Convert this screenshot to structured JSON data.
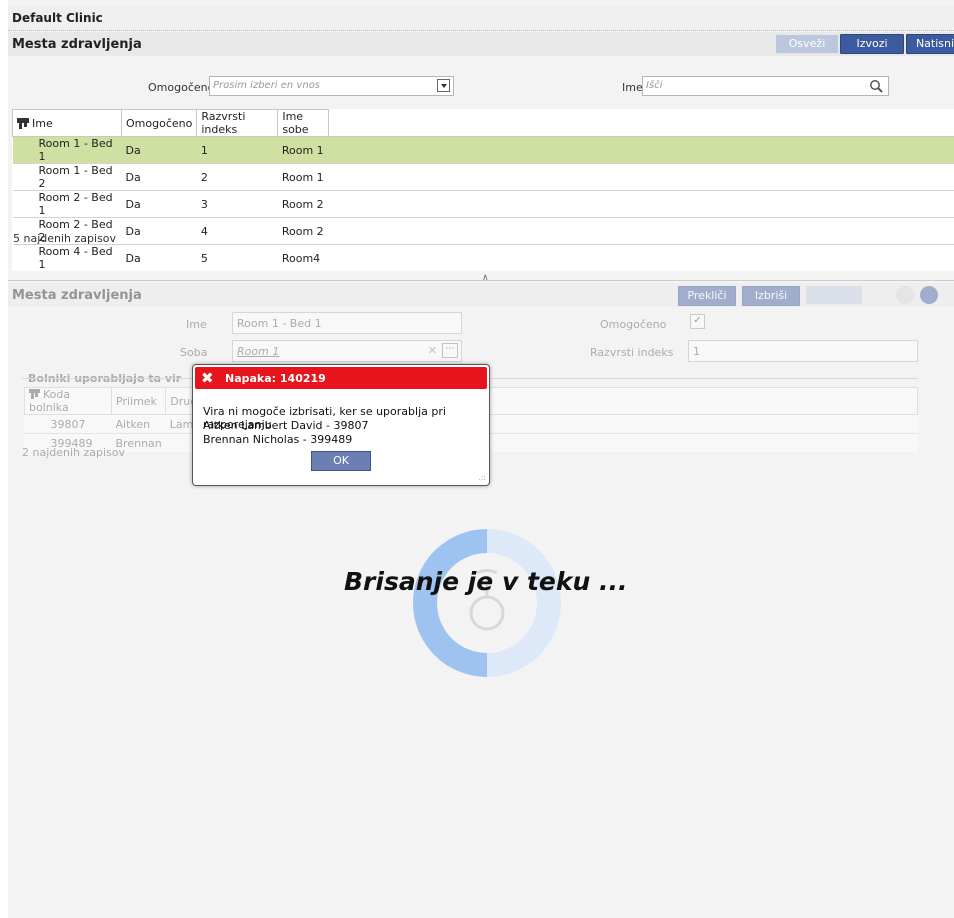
{
  "header": {
    "clinic": "Default Clinic"
  },
  "top_section": {
    "title": "Mesta zdravljenja",
    "buttons": {
      "refresh": "Osveži",
      "export_excel": "Izvozi Excel",
      "print": "Natisni"
    },
    "filter": {
      "enabled_label": "Omogočeno",
      "enabled_placeholder": "Prosim izberi en vnos",
      "name_label": "Ime",
      "name_placeholder": "Išči"
    },
    "table": {
      "headers": [
        "Ime",
        "Omogočeno",
        "Razvrsti indeks",
        "Ime sobe"
      ],
      "rows": [
        [
          "Room 1 - Bed 1",
          "Da",
          "1",
          "Room 1"
        ],
        [
          "Room 1 - Bed 2",
          "Da",
          "2",
          "Room 1"
        ],
        [
          "Room 2 - Bed 1",
          "Da",
          "3",
          "Room 2"
        ],
        [
          "Room 2 - Bed 2",
          "Da",
          "4",
          "Room 2"
        ],
        [
          "Room 4 - Bed 1",
          "Da",
          "5",
          "Room4"
        ]
      ],
      "count": "5 najdenih zapisov"
    }
  },
  "detail": {
    "title": "Mesta zdravljenja",
    "buttons": {
      "cancel": "Prekliči",
      "delete": "Izbriši"
    },
    "fields": {
      "name_label": "Ime",
      "name_value": "Room 1 - Bed 1",
      "room_label": "Soba",
      "room_value": "Room 1",
      "enabled_label": "Omogočeno",
      "sort_label": "Razvrsti indeks",
      "sort_value": "1"
    },
    "patients": {
      "title": "Bolniki uporabljajo ta vir",
      "headers": [
        "Koda bolnika",
        "Priimek",
        "Drug"
      ],
      "rows": [
        [
          "39807",
          "Aitken",
          "Laml"
        ],
        [
          "399489",
          "Brennan",
          ""
        ]
      ],
      "count": "2 najdenih zapisov"
    }
  },
  "error_dialog": {
    "title": "Napaka:  140219",
    "lines": [
      "Vira ni mogoče izbrisati, ker se uporablja pri razporejanju",
      "Aitken Lambert David - 39807",
      "Brennan  Nicholas - 399489"
    ],
    "ok": "OK"
  },
  "loading": {
    "text": "Brisanje je v teku ..."
  },
  "colors": {
    "error_red": "#e8141b",
    "selected_row": "#cfe0a2",
    "primary_button": "#3c5a9e",
    "spinner": "#9ec3f0"
  }
}
